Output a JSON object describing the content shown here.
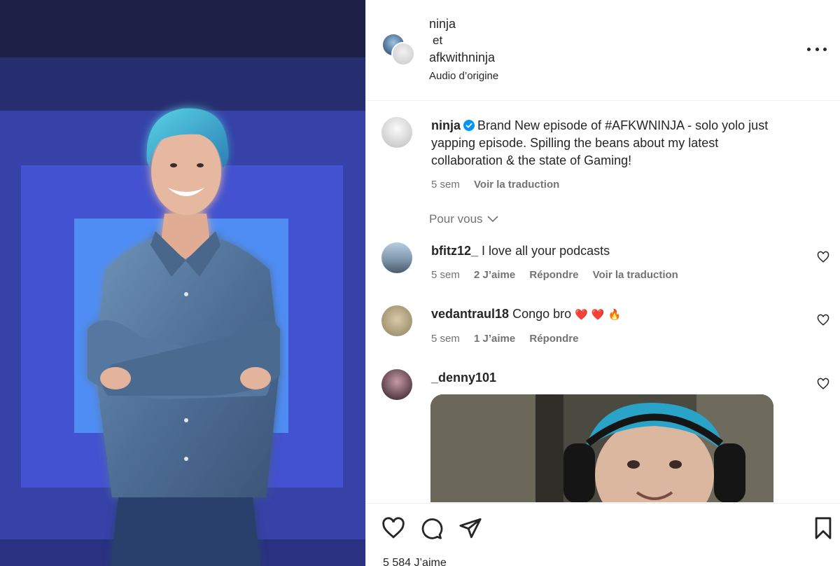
{
  "post": {
    "header": {
      "user1": "ninja",
      "joiner": "et",
      "user2": "afkwithninja",
      "audio": "Audio d’origine"
    },
    "caption": {
      "user": "ninja",
      "text": "Brand New episode of #AFKWNINJA - solo yolo just yapping episode. Spilling the beans about my latest collaboration & the state of Gaming!",
      "time": "5 sem",
      "translate": "Voir la traduction"
    },
    "sort_label": "Pour vous",
    "comments": [
      {
        "user": "bfitz12_",
        "text": "I love all your podcasts",
        "time": "5 sem",
        "likes": "2 J’aime",
        "reply": "Répondre",
        "translate": "Voir la traduction"
      },
      {
        "user": "vedantraul18",
        "text": "Congo bro",
        "emojis": [
          "❤️",
          "❤️",
          "🔥"
        ],
        "time": "5 sem",
        "likes": "1 J’aime",
        "reply": "Répondre"
      },
      {
        "user": "_denny101"
      }
    ],
    "likes_count": "5 584 J’aime"
  },
  "icons": {
    "more": "more-horizontal-icon",
    "like": "heart-icon",
    "comment": "comment-icon",
    "share": "share-icon",
    "save": "bookmark-icon",
    "verified": "verified-badge-icon",
    "chevron": "chevron-down-icon"
  },
  "colors": {
    "verified": "#0095f6",
    "heart_emoji": "#e0245e",
    "muted_text": "#737373"
  }
}
